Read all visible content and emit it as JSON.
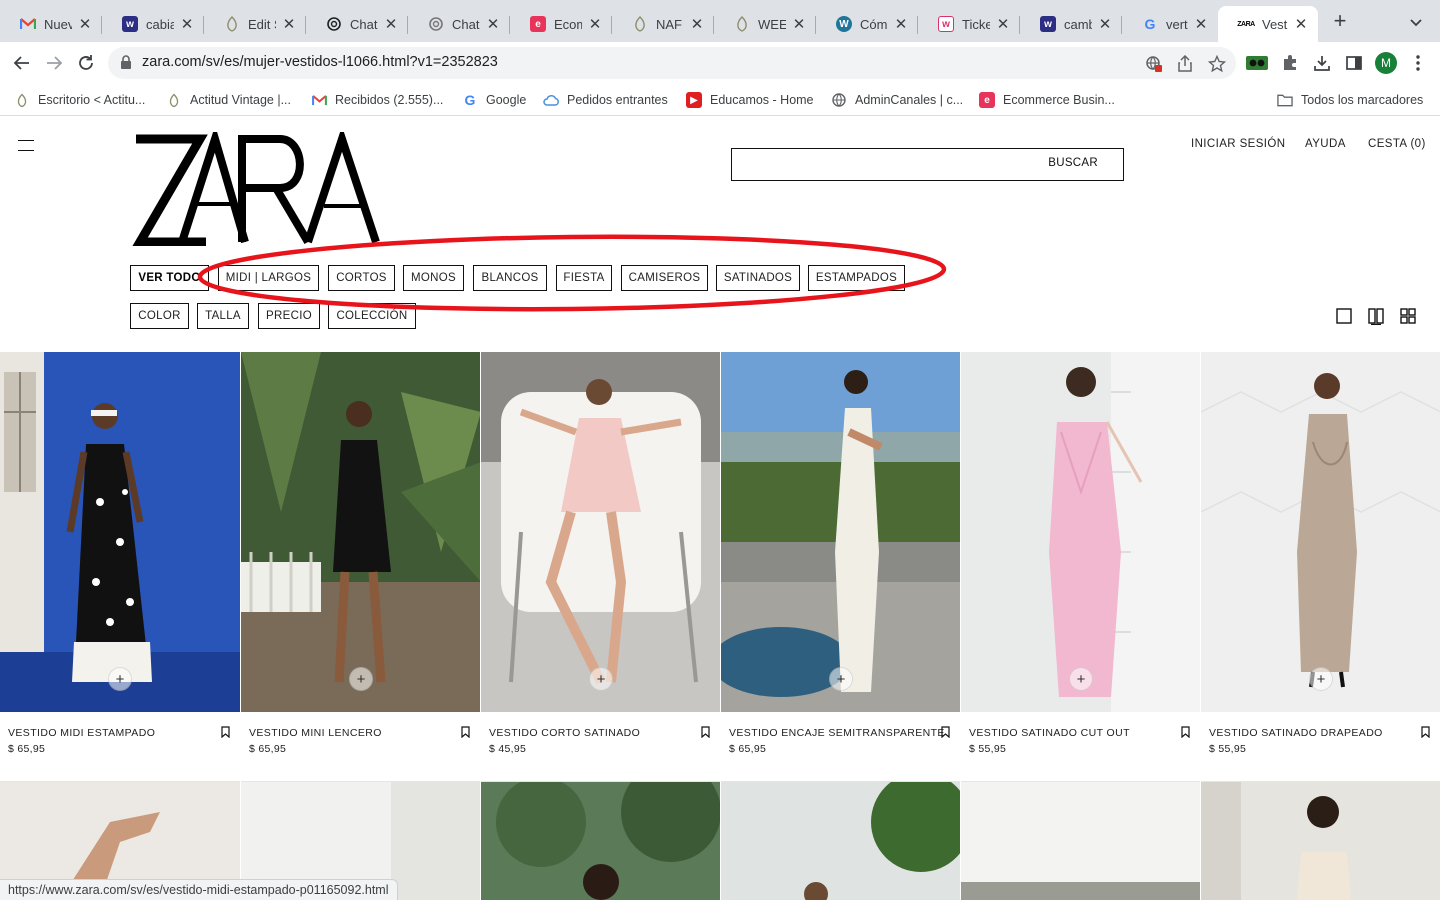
{
  "browser": {
    "tabs": [
      {
        "title": "Nueva",
        "favicon": "gmail-icon",
        "color": "#ea4335"
      },
      {
        "title": "cabiar",
        "favicon": "wix-icon",
        "color": "#2b2e83"
      },
      {
        "title": "Edit Si",
        "favicon": "site-leaf-icon",
        "color": "#8a8f6a"
      },
      {
        "title": "ChatG",
        "favicon": "openai-icon",
        "color": "#202123"
      },
      {
        "title": "ChatG",
        "favicon": "openai-icon",
        "color": "#666666"
      },
      {
        "title": "Ecomr",
        "favicon": "ecommerce-icon",
        "color": "#e8345a"
      },
      {
        "title": "NAF N",
        "favicon": "site-leaf-icon",
        "color": "#8a8f6a"
      },
      {
        "title": "WEEKI",
        "favicon": "site-leaf-icon",
        "color": "#8a8f6a"
      },
      {
        "title": "Cómo",
        "favicon": "wordpress-icon",
        "color": "#21759b"
      },
      {
        "title": "Ticket",
        "favicon": "ticket-icon",
        "color": "#d6336c"
      },
      {
        "title": "cambi",
        "favicon": "wix-icon",
        "color": "#2b2e83"
      },
      {
        "title": "vertec",
        "favicon": "google-icon",
        "color": "#4285f4"
      },
      {
        "title": "Vestid",
        "favicon": "zara-icon",
        "color": "#000000"
      }
    ],
    "url": "zara.com/sv/es/mujer-vestidos-l1066.html?v1=2352823",
    "profile_initial": "M",
    "bookmarks": [
      {
        "label": "Escritorio < Actitu...",
        "icon": "site-leaf-icon"
      },
      {
        "label": "Actitud Vintage |...",
        "icon": "site-leaf-icon"
      },
      {
        "label": "Recibidos (2.555)...",
        "icon": "gmail-icon"
      },
      {
        "label": "Google",
        "icon": "google-icon"
      },
      {
        "label": "Pedidos entrantes",
        "icon": "cloud-icon"
      },
      {
        "label": "Educamos - Home",
        "icon": "educamos-icon"
      },
      {
        "label": "AdminCanales | c...",
        "icon": "globe-icon"
      },
      {
        "label": "Ecommerce Busin...",
        "icon": "ecommerce-icon"
      }
    ],
    "all_bookmarks": "Todos los marcadores",
    "status_url": "https://www.zara.com/sv/es/vestido-midi-estampado-p01165092.html"
  },
  "header": {
    "brand": "ZARA",
    "search_label": "BUSCAR",
    "login": "INICIAR SESIÓN",
    "help": "AYUDA",
    "cart": "CESTA (0)"
  },
  "categories": [
    "VER TODO",
    "MIDI | LARGOS",
    "CORTOS",
    "MONOS",
    "BLANCOS",
    "FIESTA",
    "CAMISEROS",
    "SATINADOS",
    "ESTAMPADOS"
  ],
  "filters": [
    "COLOR",
    "TALLA",
    "PRECIO",
    "COLECCIÓN"
  ],
  "annotation_color": "#e8141b",
  "products": [
    {
      "name": "VESTIDO MIDI ESTAMPADO",
      "price": "$ 65,95"
    },
    {
      "name": "VESTIDO MINI LENCERO",
      "price": "$ 65,95"
    },
    {
      "name": "VESTIDO CORTO SATINADO",
      "price": "$ 45,95"
    },
    {
      "name": "VESTIDO ENCAJE SEMITRANSPARENTE",
      "price": "$ 65,95"
    },
    {
      "name": "VESTIDO SATINADO CUT OUT",
      "price": "$ 55,95"
    },
    {
      "name": "VESTIDO SATINADO DRAPEADO",
      "price": "$ 55,95"
    }
  ]
}
